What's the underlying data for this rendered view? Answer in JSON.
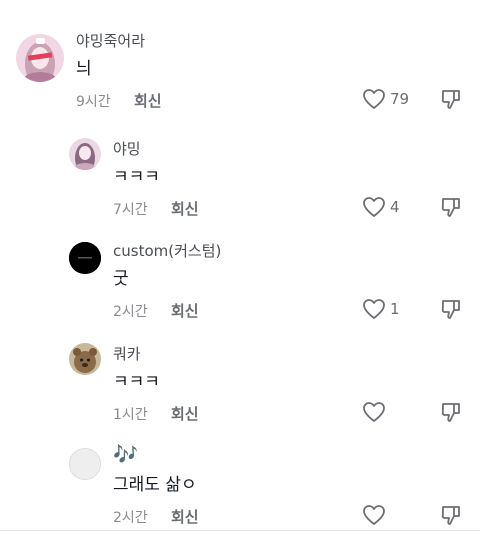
{
  "comments": [
    {
      "username": "야밍죽어라",
      "text": "늬",
      "time": "9시간",
      "reply_label": "회신",
      "likes": "79",
      "avatar": "girl-photo-avatar"
    },
    {
      "username": "야밍",
      "text": "ㅋㅋㅋ",
      "time": "7시간",
      "reply_label": "회신",
      "likes": "4",
      "avatar": "girl-photo-avatar"
    },
    {
      "username": "custom(커스텀)",
      "text": "굿",
      "time": "2시간",
      "reply_label": "회신",
      "likes": "1",
      "avatar": "black-logo-avatar"
    },
    {
      "username": "쿼카",
      "text": "ㅋㅋㅋ",
      "time": "1시간",
      "reply_label": "회신",
      "likes": "",
      "avatar": "quokka-avatar"
    },
    {
      "username": "🎶",
      "text": "그래도 삶ㅇ",
      "time": "2시간",
      "reply_label": "회신",
      "likes": "",
      "avatar": "default-avatar"
    }
  ],
  "icons": {
    "like": "heart-outline-icon",
    "dislike": "thumbs-down-icon"
  },
  "colors": {
    "text": "#161823",
    "secondary": "#8a8b91",
    "background": "#ffffff"
  }
}
